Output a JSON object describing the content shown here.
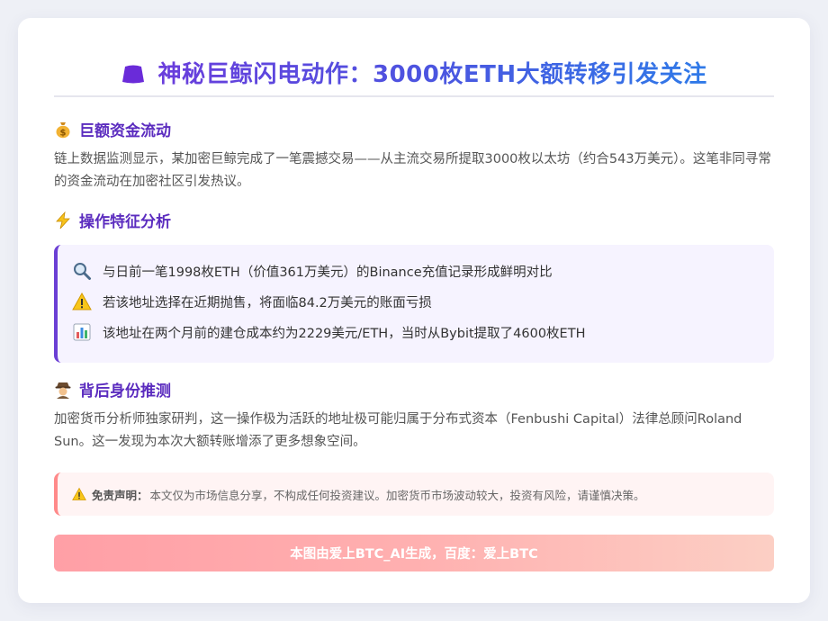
{
  "header": {
    "title": "神秘巨鲸闪电动作：3000枚ETH大额转移引发关注",
    "icon": "whale-icon",
    "accent_color": "#6a3ddc"
  },
  "sections": [
    {
      "icon": "money-bag-icon",
      "heading": "巨额资金流动",
      "paragraph": "链上数据监测显示，某加密巨鲸完成了一笔震撼交易——从主流交易所提取3000枚以太坊（约合543万美元）。这笔非同寻常的资金流动在加密社区引发热议。"
    },
    {
      "icon": "lightning-icon",
      "heading": "操作特征分析",
      "items": [
        {
          "icon": "magnifier-icon",
          "text": "与日前一笔1998枚ETH（价值361万美元）的Binance充值记录形成鲜明对比"
        },
        {
          "icon": "warning-icon",
          "text": "若该地址选择在近期抛售，将面临84.2万美元的账面亏损"
        },
        {
          "icon": "bar-chart-icon",
          "text": "该地址在两个月前的建仓成本约为2229美元/ETH，当时从Bybit提取了4600枚ETH"
        }
      ]
    },
    {
      "icon": "detective-icon",
      "heading": "背后身份推测",
      "paragraph": "加密货币分析师独家研判，这一操作极为活跃的地址极可能归属于分布式资本（Fenbushi Capital）法律总顾问Roland Sun。这一发现为本次大额转账增添了更多想象空间。"
    }
  ],
  "disclaimer": {
    "icon": "warning-icon",
    "label": "免责声明：",
    "text": "本文仅为市场信息分享，不构成任何投资建议。加密货币市场波动较大，投资有风险，请谨慎决策。"
  },
  "footer": {
    "text": "本图由爱上BTC_AI生成，百度：爱上BTC"
  }
}
